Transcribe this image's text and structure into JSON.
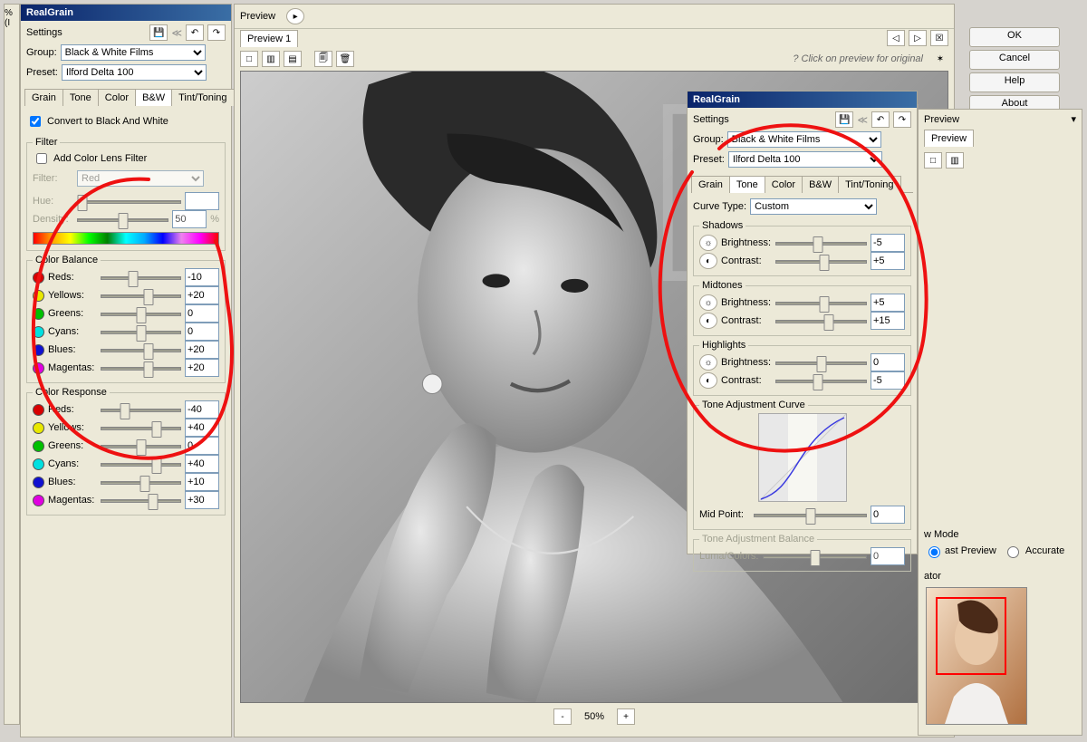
{
  "app_title": "RealGrain",
  "left_badge": "% (I",
  "buttons": {
    "ok": "OK",
    "cancel": "Cancel",
    "help": "Help",
    "about": "About"
  },
  "settings_label": "Settings",
  "group_label": "Group:",
  "preset_label": "Preset:",
  "group_value": "Black & White Films",
  "preset_value": "Ilford Delta 100",
  "tabs": {
    "grain": "Grain",
    "tone": "Tone",
    "color": "Color",
    "bw": "B&W",
    "tint": "Tint/Toning"
  },
  "convert_label": "Convert to Black And White",
  "filter": {
    "legend": "Filter",
    "add": "Add Color Lens Filter",
    "filter_label": "Filter:",
    "filter_value": "Red",
    "hue": "Hue:",
    "density": "Density:",
    "density_val": "50",
    "pct": "%"
  },
  "color_balance": {
    "legend": "Color Balance",
    "items": [
      {
        "color": "#d80000",
        "name": "Reds:",
        "val": "-10",
        "pos": 40
      },
      {
        "color": "#e8e800",
        "name": "Yellows:",
        "val": "+20",
        "pos": 60
      },
      {
        "color": "#00c000",
        "name": "Greens:",
        "val": "0",
        "pos": 50
      },
      {
        "color": "#00e0e0",
        "name": "Cyans:",
        "val": "0",
        "pos": 50
      },
      {
        "color": "#1010d0",
        "name": "Blues:",
        "val": "+20",
        "pos": 60
      },
      {
        "color": "#e000e0",
        "name": "Magentas:",
        "val": "+20",
        "pos": 60
      }
    ]
  },
  "color_response": {
    "legend": "Color Response",
    "items": [
      {
        "color": "#d80000",
        "name": "Reds:",
        "val": "-40",
        "pos": 30
      },
      {
        "color": "#e8e800",
        "name": "Yellows:",
        "val": "+40",
        "pos": 70
      },
      {
        "color": "#00c000",
        "name": "Greens:",
        "val": "0",
        "pos": 50
      },
      {
        "color": "#00e0e0",
        "name": "Cyans:",
        "val": "+40",
        "pos": 70
      },
      {
        "color": "#1010d0",
        "name": "Blues:",
        "val": "+10",
        "pos": 55
      },
      {
        "color": "#e000e0",
        "name": "Magentas:",
        "val": "+30",
        "pos": 65
      }
    ]
  },
  "preview": {
    "label": "Preview",
    "tab": "Preview 1",
    "click_hint": "Click on preview for original",
    "zoom": "50%"
  },
  "right": {
    "curve_type_label": "Curve Type:",
    "curve_type_value": "Custom",
    "shadows": {
      "legend": "Shadows",
      "bright": "Brightness:",
      "bright_val": "-5",
      "contrast": "Contrast:",
      "contrast_val": "+5"
    },
    "midtones": {
      "legend": "Midtones",
      "bright": "Brightness:",
      "bright_val": "+5",
      "contrast": "Contrast:",
      "contrast_val": "+15"
    },
    "highlights": {
      "legend": "Highlights",
      "bright": "Brightness:",
      "bright_val": "0",
      "contrast": "Contrast:",
      "contrast_val": "-5"
    },
    "tone_curve": {
      "legend": "Tone Adjustment Curve",
      "midpoint": "Mid Point:",
      "midpoint_val": "0"
    },
    "tone_balance": {
      "legend": "Tone Adjustment Balance",
      "luma": "Luma/Colors:",
      "luma_val": "0"
    }
  },
  "mode": {
    "label": "w Mode",
    "fast": "ast Preview",
    "accurate": "Accurate"
  },
  "nav": "ator",
  "rpreview": "Preview"
}
